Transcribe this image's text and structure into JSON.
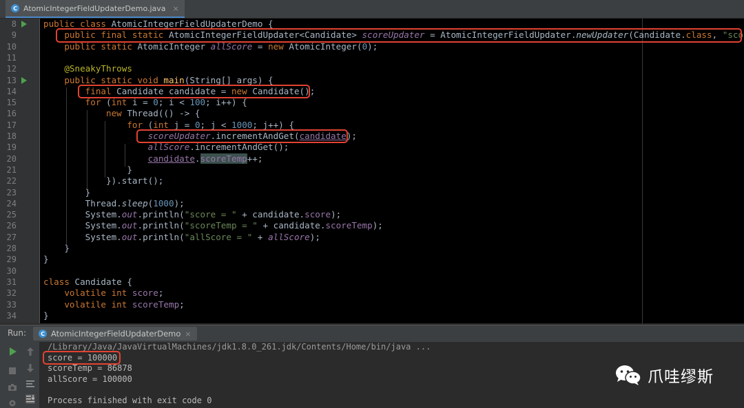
{
  "editor_tab": {
    "filename": "AtomicIntegerFieldUpdaterDemo.java",
    "icon": "java-class-icon"
  },
  "code_lines": [
    {
      "n": "8",
      "run": true,
      "segs": [
        [
          "kw",
          "public class "
        ],
        [
          "cls",
          "AtomicIntegerFieldUpdaterDemo {"
        ]
      ]
    },
    {
      "n": "9",
      "run": false,
      "segs": [
        [
          "kw",
          "    public final static "
        ],
        [
          "cls",
          "AtomicIntegerFieldUpdater<Candidate> "
        ],
        [
          "fld ital",
          "scoreUpdater"
        ],
        [
          "cls",
          " = AtomicIntegerFieldUpdater."
        ],
        [
          "ital",
          "newUpdater"
        ],
        [
          "cls",
          "(Candidate."
        ],
        [
          "kw",
          "class"
        ],
        [
          "cls",
          ", "
        ],
        [
          "str",
          "\"score\""
        ],
        [
          "cls",
          ");"
        ]
      ]
    },
    {
      "n": "10",
      "run": false,
      "segs": [
        [
          "kw",
          "    public static "
        ],
        [
          "cls",
          "AtomicInteger "
        ],
        [
          "fld ital",
          "allScore"
        ],
        [
          "cls",
          " = "
        ],
        [
          "kw",
          "new "
        ],
        [
          "cls",
          "AtomicInteger("
        ],
        [
          "num",
          "0"
        ],
        [
          "cls",
          ");"
        ]
      ]
    },
    {
      "n": "11",
      "run": false,
      "segs": []
    },
    {
      "n": "12",
      "run": false,
      "segs": [
        [
          "ann",
          "    @SneakyThrows"
        ]
      ]
    },
    {
      "n": "13",
      "run": true,
      "segs": [
        [
          "kw",
          "    public static void "
        ],
        [
          "mth",
          "main"
        ],
        [
          "cls",
          "(String[] args) {"
        ]
      ]
    },
    {
      "n": "14",
      "run": false,
      "segs": [
        [
          "kw",
          "        final "
        ],
        [
          "cls",
          "Candidate candidate = "
        ],
        [
          "kw",
          "new "
        ],
        [
          "cls",
          "Candidate();"
        ]
      ]
    },
    {
      "n": "15",
      "run": false,
      "segs": [
        [
          "kw",
          "        for "
        ],
        [
          "cls",
          "("
        ],
        [
          "kw",
          "int "
        ],
        [
          "cls",
          "i = "
        ],
        [
          "num",
          "0"
        ],
        [
          "cls",
          "; i < "
        ],
        [
          "num",
          "100"
        ],
        [
          "cls",
          "; i++) {"
        ]
      ]
    },
    {
      "n": "16",
      "run": false,
      "segs": [
        [
          "kw",
          "            new "
        ],
        [
          "cls",
          "Thread(() -> {"
        ]
      ]
    },
    {
      "n": "17",
      "run": false,
      "segs": [
        [
          "kw",
          "                for "
        ],
        [
          "cls",
          "("
        ],
        [
          "kw",
          "int "
        ],
        [
          "cls",
          "j = "
        ],
        [
          "num",
          "0"
        ],
        [
          "cls",
          "; j < "
        ],
        [
          "num",
          "1000"
        ],
        [
          "cls",
          "; j++) {"
        ]
      ]
    },
    {
      "n": "18",
      "run": false,
      "segs": [
        [
          "cls",
          "                    "
        ],
        [
          "fld ital",
          "scoreUpdater"
        ],
        [
          "cls",
          ".incrementAndGet("
        ],
        [
          "fld under",
          "candidate"
        ],
        [
          "cls",
          ");"
        ]
      ]
    },
    {
      "n": "19",
      "run": false,
      "segs": [
        [
          "cls",
          "                    "
        ],
        [
          "fld ital",
          "allScore"
        ],
        [
          "cls",
          ".incrementAndGet();"
        ]
      ]
    },
    {
      "n": "20",
      "run": false,
      "segs": [
        [
          "cls",
          "                    "
        ],
        [
          "fld under",
          "candidate"
        ],
        [
          "cls",
          "."
        ],
        [
          "fld hl-ref",
          "scoreTemp"
        ],
        [
          "cls",
          "++;"
        ]
      ]
    },
    {
      "n": "21",
      "run": false,
      "segs": [
        [
          "cls",
          "                }"
        ]
      ]
    },
    {
      "n": "22",
      "run": false,
      "segs": [
        [
          "cls",
          "            }).start();"
        ]
      ]
    },
    {
      "n": "23",
      "run": false,
      "segs": [
        [
          "cls",
          "        }"
        ]
      ]
    },
    {
      "n": "24",
      "run": false,
      "segs": [
        [
          "cls",
          "        Thread."
        ],
        [
          "ital",
          "sleep"
        ],
        [
          "cls",
          "("
        ],
        [
          "num",
          "1000"
        ],
        [
          "cls",
          ");"
        ]
      ]
    },
    {
      "n": "25",
      "run": false,
      "segs": [
        [
          "cls",
          "        System."
        ],
        [
          "fld ital",
          "out"
        ],
        [
          "cls",
          ".println("
        ],
        [
          "str",
          "\"score = \""
        ],
        [
          "cls",
          " + candidate."
        ],
        [
          "fld",
          "score"
        ],
        [
          "cls",
          ");"
        ]
      ]
    },
    {
      "n": "26",
      "run": false,
      "segs": [
        [
          "cls",
          "        System."
        ],
        [
          "fld ital",
          "out"
        ],
        [
          "cls",
          ".println("
        ],
        [
          "str",
          "\"scoreTemp = \""
        ],
        [
          "cls",
          " + candidate."
        ],
        [
          "fld",
          "scoreTemp"
        ],
        [
          "cls",
          ");"
        ]
      ]
    },
    {
      "n": "27",
      "run": false,
      "segs": [
        [
          "cls",
          "        System."
        ],
        [
          "fld ital",
          "out"
        ],
        [
          "cls",
          ".println("
        ],
        [
          "str",
          "\"allScore = \""
        ],
        [
          "cls",
          " + "
        ],
        [
          "fld ital",
          "allScore"
        ],
        [
          "cls",
          ");"
        ]
      ]
    },
    {
      "n": "28",
      "run": false,
      "segs": [
        [
          "cls",
          "    }"
        ]
      ]
    },
    {
      "n": "29",
      "run": false,
      "segs": [
        [
          "cls",
          "}"
        ]
      ]
    },
    {
      "n": "30",
      "run": false,
      "segs": []
    },
    {
      "n": "31",
      "run": false,
      "segs": [
        [
          "kw",
          "class "
        ],
        [
          "cls",
          "Candidate {"
        ]
      ]
    },
    {
      "n": "32",
      "run": false,
      "segs": [
        [
          "kw",
          "    volatile int "
        ],
        [
          "fld",
          "score"
        ],
        [
          "cls",
          ";"
        ]
      ]
    },
    {
      "n": "33",
      "run": false,
      "segs": [
        [
          "kw",
          "    volatile int "
        ],
        [
          "fld",
          "scoreTemp"
        ],
        [
          "cls",
          ";"
        ]
      ]
    },
    {
      "n": "34",
      "run": false,
      "segs": [
        [
          "cls",
          "}"
        ]
      ]
    }
  ],
  "run_panel": {
    "label": "Run:",
    "tab": "AtomicIntegerFieldUpdaterDemo",
    "console_lines": [
      "/Library/Java/JavaVirtualMachines/jdk1.8.0_261.jdk/Contents/Home/bin/java ...",
      "score = 100000",
      "scoreTemp = 86878",
      "allScore = 100000",
      "",
      "Process finished with exit code 0"
    ]
  },
  "watermark": {
    "text": "爪哇缪斯",
    "icon": "wechat-icon"
  }
}
